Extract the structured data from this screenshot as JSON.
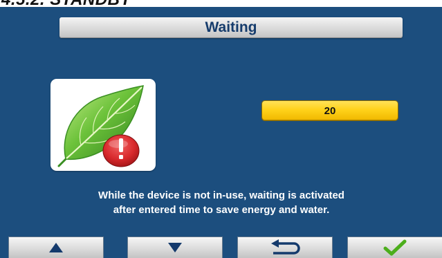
{
  "document": {
    "heading": "4.5.2. STANDBY"
  },
  "header": {
    "title": "Waiting"
  },
  "setting": {
    "value": "20"
  },
  "description": {
    "line1": "While the device is not in-use, waiting is activated",
    "line2": "after entered time to save energy and water."
  },
  "icons": {
    "status_icon": "leaf-with-warning-icon",
    "up": "arrow-up-icon",
    "down": "arrow-down-icon",
    "back": "return-arrow-icon",
    "confirm": "checkmark-icon"
  },
  "colors": {
    "screen_background": "#1c4e7e",
    "title_text": "#163c6c",
    "value_field": "#ffd21a",
    "leaf": "#5cb82c",
    "warning_badge": "#d8292c",
    "confirm_check": "#4cae1c",
    "nav_arrows": "#143a6c"
  }
}
